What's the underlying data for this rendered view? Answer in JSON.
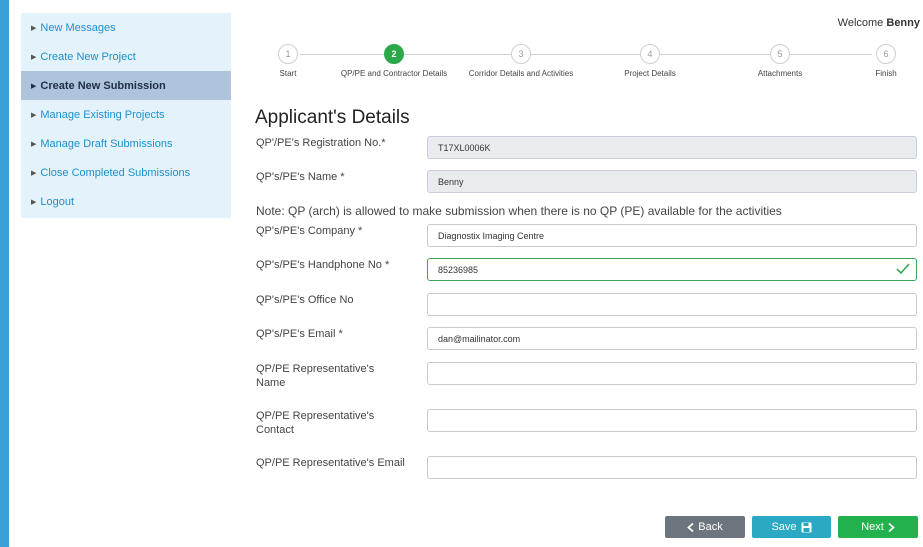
{
  "sidebar": {
    "items": [
      {
        "label": "New Messages"
      },
      {
        "label": "Create New Project"
      },
      {
        "label": "Create New Submission"
      },
      {
        "label": "Manage Existing Projects"
      },
      {
        "label": "Manage Draft Submissions"
      },
      {
        "label": "Close Completed Submissions"
      },
      {
        "label": "Logout"
      }
    ]
  },
  "header": {
    "welcome_prefix": "Welcome",
    "user_name": "Benny"
  },
  "stepper": {
    "steps": [
      {
        "number": "1",
        "label": "Start"
      },
      {
        "number": "2",
        "label": "QP/PE and Contractor Details"
      },
      {
        "number": "3",
        "label": "Corridor Details and Activities"
      },
      {
        "number": "4",
        "label": "Project Details"
      },
      {
        "number": "5",
        "label": "Attachments"
      },
      {
        "number": "6",
        "label": "Finish"
      }
    ]
  },
  "form": {
    "title": "Applicant's Details",
    "registration_label": "QP'/PE's Registration No.*",
    "registration_value": "T17XL0006K",
    "name_label": "QP's/PE's Name *",
    "name_value": "Benny",
    "note": "Note: QP (arch) is allowed to make submission when there is no QP (PE) available for the activities",
    "company_label": "QP's/PE's Company *",
    "company_value": "Diagnostix Imaging Centre",
    "handphone_label": "QP's/PE's Handphone No *",
    "handphone_value": "85236985",
    "office_label": "QP's/PE's Office No",
    "office_value": "",
    "email_label": "QP's/PE's Email *",
    "email_value": "dan@mailinator.com",
    "rep_name_label": "QP/PE Representative's Name",
    "rep_name_value": "",
    "rep_contact_label": "QP/PE Representative's Contact",
    "rep_contact_value": "",
    "rep_email_label": "QP/PE Representative's Email",
    "rep_email_value": ""
  },
  "actions": {
    "back": "Back",
    "save": "Save",
    "next": "Next"
  },
  "colors": {
    "primary": "#1c8fcf",
    "success": "#22b14c",
    "info": "#2aa8c4",
    "secondary": "#6c757d"
  }
}
